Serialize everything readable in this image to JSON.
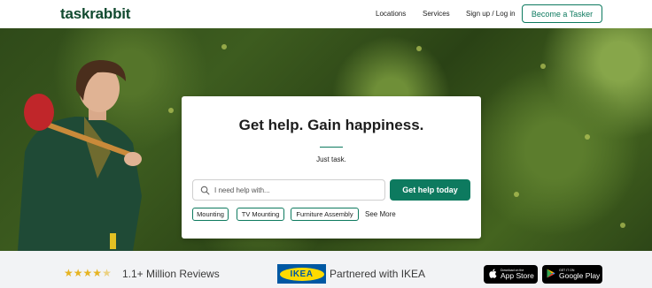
{
  "nav": {
    "logo": "taskrabbit",
    "links": [
      "Locations",
      "Services",
      "Sign up / Log in"
    ],
    "tasker_button": "Become a Tasker"
  },
  "hero": {
    "title": "Get help. Gain happiness.",
    "subtitle": "Just task.",
    "search_placeholder": "I need help with...",
    "cta": "Get help today",
    "chips": [
      "Mounting",
      "TV Mounting",
      "Furniture Assembly"
    ],
    "see_more": "See More"
  },
  "strip": {
    "rating": 4.5,
    "reviews": "1.1+ Million Reviews",
    "partner_logo": "IKEA",
    "partner_text": "Partnered with IKEA",
    "app_store_small": "Download on the",
    "app_store_big": "App Store",
    "play_store_small": "GET IT ON",
    "play_store_big": "Google Play"
  },
  "colors": {
    "brand_green": "#0d7a5f",
    "logo_green": "#114a2f",
    "star": "#e6b423",
    "ikea_blue": "#0058a3",
    "ikea_yellow": "#ffdb00"
  },
  "icons": [
    "search-icon",
    "star-icon",
    "apple-icon",
    "google-play-icon"
  ]
}
